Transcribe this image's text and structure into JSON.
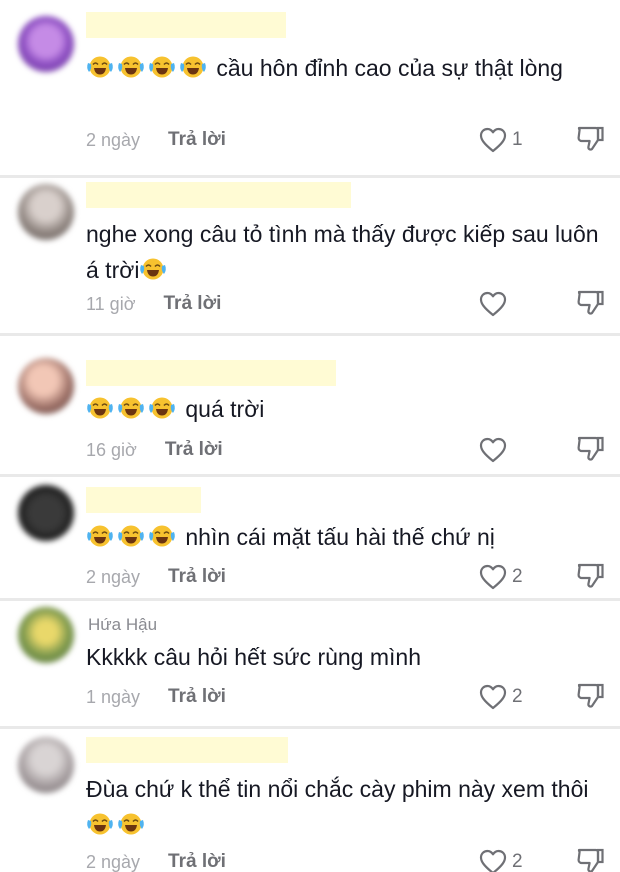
{
  "comments": [
    {
      "author": "",
      "text": "cầu hôn đỉnh cao của sự thật lòng",
      "emoji_before": 4,
      "emoji_after": 0,
      "time": "2 ngày",
      "reply": "Trả lời",
      "likes": "1"
    },
    {
      "author": "",
      "text": "nghe xong câu tỏ tình mà thấy được kiếp sau luôn á trời",
      "emoji_before": 0,
      "emoji_after": 1,
      "time": "11 giờ",
      "reply": "Trả lời",
      "likes": ""
    },
    {
      "author": "",
      "text": "quá trời",
      "emoji_before": 3,
      "emoji_after": 0,
      "time": "16 giờ",
      "reply": "Trả lời",
      "likes": ""
    },
    {
      "author": "",
      "text": "nhìn cái mặt tấu hài thế chứ nị",
      "emoji_before": 3,
      "emoji_after": 0,
      "time": "2 ngày",
      "reply": "Trả lời",
      "likes": "2"
    },
    {
      "author": "Hứa Hậu",
      "text": "Kkkkk câu hỏi hết sức rùng mình",
      "emoji_before": 0,
      "emoji_after": 0,
      "time": "1 ngày",
      "reply": "Trả lời",
      "likes": "2"
    },
    {
      "author": "",
      "text": "Đùa chứ k thể tin nổi chắc cày phim này xem thôi",
      "emoji_before": 0,
      "emoji_after": 2,
      "time": "2 ngày",
      "reply": "Trả lời",
      "likes": "2"
    }
  ],
  "icons": {
    "like": "heart-outline-icon",
    "dislike": "thumbs-down-icon",
    "emoji": "face-with-tears-of-joy-emoji"
  },
  "colors": {
    "background": "#ffffff",
    "text": "#161823",
    "muted": "#a7a8ad",
    "emoji": "#f7c22f"
  }
}
